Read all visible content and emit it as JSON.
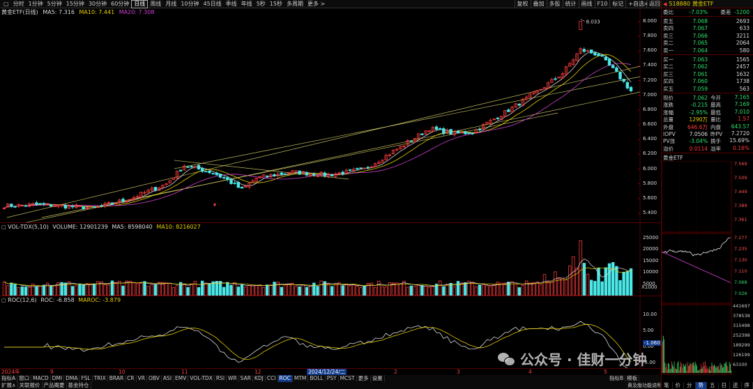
{
  "toolbar": {
    "periods": [
      "分时",
      "1分钟",
      "5分钟",
      "15分钟",
      "30分钟",
      "60分钟",
      "日线",
      "周线",
      "月线",
      "10分钟",
      "45日线",
      "季线",
      "年线",
      "5秒",
      "15秒",
      "多周期",
      "更多 >"
    ],
    "active_period": "日线",
    "tools": [
      "复权",
      "叠加",
      "多股",
      "统计",
      "画线",
      "F10",
      "标记",
      "+自选",
      "返回"
    ]
  },
  "main_chart": {
    "legend_name": "黄金ETF(日线)",
    "ma5": "MA5: 7.316",
    "ma10": "MA10: 7.441",
    "ma20": "MA20: 7.308",
    "high_label": "8.033",
    "y_ticks": [
      "8.000",
      "7.800",
      "7.600",
      "7.400",
      "7.200",
      "7.000",
      "6.800",
      "6.600",
      "6.400",
      "6.200",
      "6.000",
      "5.800",
      "5.600",
      "5.400"
    ]
  },
  "volume_chart": {
    "legend_name": "VOL-TDX(5,10)",
    "volume": "VOLUME: 12901239",
    "ma5": "MA5: 8598040",
    "ma10": "MA10: 8216027",
    "y_ticks": [
      "25000",
      "20000",
      "15000",
      "10000",
      "5000"
    ],
    "unit": "X1000"
  },
  "roc_chart": {
    "legend_name": "ROC(12,6)",
    "roc": "ROC: -6.858",
    "maroc": "MAROC: -3.879",
    "y_ticks": [
      "10.00",
      "5.00",
      "0.00",
      "-5.00"
    ],
    "current_value": "-1.060"
  },
  "time_axis": {
    "labels": [
      "2024年",
      "9",
      "10",
      "11",
      "12",
      "2",
      "3",
      "4",
      "5"
    ],
    "highlight": "2024/12/24/二"
  },
  "indicators": [
    "指标A",
    "窗口",
    "MACD",
    "DMI",
    "DMA",
    "FSL",
    "TRIX",
    "BRAR",
    "CR",
    "VR",
    "OBV",
    "ASI",
    "EMV",
    "VOL-TDX",
    "RSI",
    "WR",
    "SAR",
    "KDJ",
    "CCI",
    "ROC",
    "MTM",
    "BOLL",
    "PSY",
    "MCST",
    "更多",
    "设置"
  ],
  "active_indicator": "ROC",
  "bottom_tabs": [
    "扩展∧",
    "关联报价",
    "产品概要",
    "基金持仓"
  ],
  "right_tabs": [
    "指标B",
    "模板"
  ],
  "bottom_right_label": "黄及版功能说明",
  "bottom_right_buttons": [
    "笔",
    "价",
    "分",
    "势",
    "五",
    "日",
    "还",
    "序"
  ],
  "quote": {
    "code": "518880",
    "name": "黄金ETF",
    "wei_bi_label": "委比",
    "wei_bi": "-7.03%",
    "wei_cha_label": "委差",
    "wei_cha": "-1200",
    "sell": [
      {
        "label": "卖五",
        "price": "7.068",
        "vol": "2693"
      },
      {
        "label": "卖四",
        "price": "7.067",
        "vol": "633"
      },
      {
        "label": "卖三",
        "price": "7.066",
        "vol": "3211"
      },
      {
        "label": "卖二",
        "price": "7.065",
        "vol": "2064"
      },
      {
        "label": "卖一",
        "price": "7.064",
        "vol": "580"
      }
    ],
    "buy": [
      {
        "label": "买一",
        "price": "7.063",
        "vol": "1565"
      },
      {
        "label": "买二",
        "price": "7.062",
        "vol": "2457"
      },
      {
        "label": "买三",
        "price": "7.061",
        "vol": "1632"
      },
      {
        "label": "买四",
        "price": "7.060",
        "vol": "1738"
      },
      {
        "label": "买五",
        "price": "7.059",
        "vol": "563"
      }
    ],
    "stats": [
      {
        "l1": "现价",
        "v1": "7.062",
        "l2": "今开",
        "v2": "7.165",
        "c1": "green",
        "c2": "green"
      },
      {
        "l1": "涨跌",
        "v1": "-0.215",
        "l2": "最高",
        "v2": "7.169",
        "c1": "green",
        "c2": "green"
      },
      {
        "l1": "涨幅",
        "v1": "-2.95%",
        "l2": "最低",
        "v2": "7.010",
        "c1": "green",
        "c2": "green"
      },
      {
        "l1": "总量",
        "v1": "1290万",
        "l2": "量比",
        "v2": "1.57",
        "c1": "yellow",
        "c2": "red"
      },
      {
        "l1": "外盘",
        "v1": "646.6万",
        "l2": "内盘",
        "v2": "643.57",
        "c1": "red",
        "c2": "green"
      },
      {
        "l1": "IOPV",
        "v1": "7.0506",
        "l2": "昨PV",
        "v2": "7.2720",
        "c1": "white",
        "c2": "white"
      },
      {
        "l1": "PV涨",
        "v1": "-3.04%",
        "l2": "换手",
        "v2": "15.69%",
        "c1": "green",
        "c2": "white"
      },
      {
        "l1": "溢价",
        "v1": "0.0114",
        "l2": "溢率",
        "v2": "0.16%",
        "c1": "red",
        "c2": "red"
      }
    ],
    "mini_title": "黄金ETF",
    "mini_ticks_top": [
      "7.569",
      "7.509",
      "7.449",
      "7.389",
      "7.361"
    ],
    "mini_ticks_bottom": [
      "7.277",
      "7.235",
      "7.130",
      "7.110",
      "7.068",
      "7.026"
    ],
    "vol_ticks": [
      "441697",
      "378538",
      "315498",
      "252398",
      "189299",
      "126199",
      "63100"
    ]
  },
  "watermark": "公众号 · 佳财一分钟",
  "colors": {
    "up": "#ff3b3b",
    "down": "#4ae8e8",
    "ma5": "#dddddd",
    "ma10": "#e8d000",
    "ma20": "#d040d0",
    "trend": "#e8e070"
  }
}
